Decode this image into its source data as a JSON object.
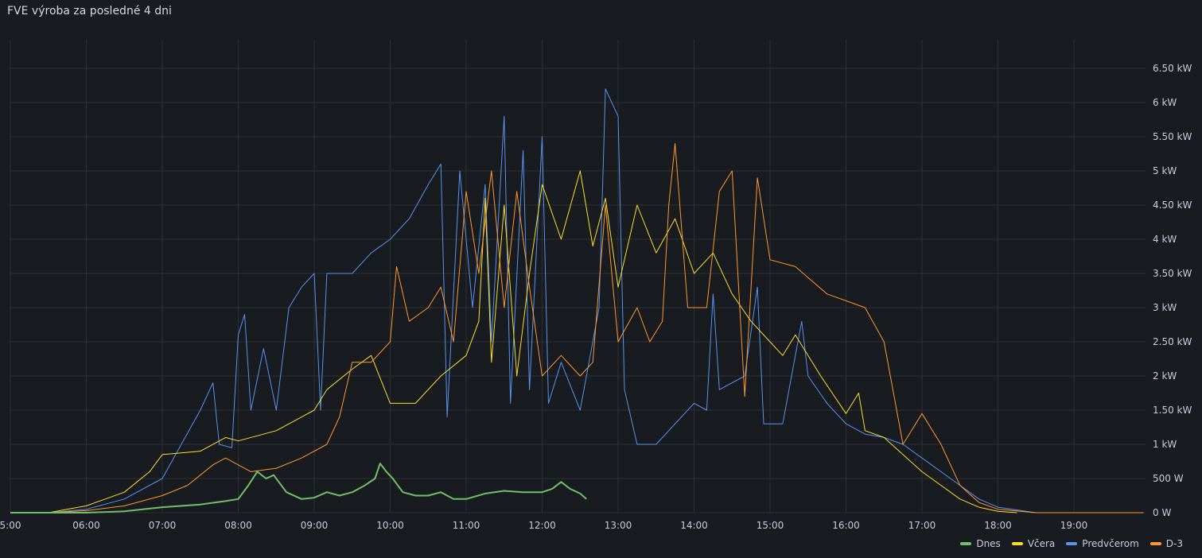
{
  "panel": {
    "title": "FVE výroba za posledné 4 dni"
  },
  "chart_data": {
    "type": "line",
    "title": "FVE výroba za posledné 4 dni",
    "xlabel": "",
    "ylabel": "",
    "xlim": [
      "05:00",
      "19:57"
    ],
    "ylim": [
      0,
      6.5
    ],
    "unit": "kW",
    "x_ticks": [
      "5:00",
      "06:00",
      "07:00",
      "08:00",
      "09:00",
      "10:00",
      "11:00",
      "12:00",
      "13:00",
      "14:00",
      "15:00",
      "16:00",
      "17:00",
      "18:00",
      "19:00"
    ],
    "y_ticks": [
      {
        "v": 0,
        "label": "0 W"
      },
      {
        "v": 0.5,
        "label": "500 W"
      },
      {
        "v": 1,
        "label": "1 kW"
      },
      {
        "v": 1.5,
        "label": "1.50 kW"
      },
      {
        "v": 2,
        "label": "2 kW"
      },
      {
        "v": 2.5,
        "label": "2.50 kW"
      },
      {
        "v": 3,
        "label": "3 kW"
      },
      {
        "v": 3.5,
        "label": "3.50 kW"
      },
      {
        "v": 4,
        "label": "4 kW"
      },
      {
        "v": 4.5,
        "label": "4.50 kW"
      },
      {
        "v": 5,
        "label": "5 kW"
      },
      {
        "v": 5.5,
        "label": "5.50 kW"
      },
      {
        "v": 6,
        "label": "6 kW"
      },
      {
        "v": 6.5,
        "label": "6.50 kW"
      }
    ],
    "grid": true,
    "legend_position": "bottom-right",
    "series": [
      {
        "name": "Predvčerom",
        "color": "#5794f2",
        "points": [
          [
            "05:30",
            0
          ],
          [
            "06:00",
            0.05
          ],
          [
            "06:30",
            0.2
          ],
          [
            "07:00",
            0.5
          ],
          [
            "07:15",
            1.0
          ],
          [
            "07:30",
            1.5
          ],
          [
            "07:40",
            1.9
          ],
          [
            "07:45",
            1.0
          ],
          [
            "07:55",
            0.95
          ],
          [
            "08:00",
            2.6
          ],
          [
            "08:05",
            2.9
          ],
          [
            "08:10",
            1.5
          ],
          [
            "08:20",
            2.4
          ],
          [
            "08:30",
            1.5
          ],
          [
            "08:40",
            3.0
          ],
          [
            "08:50",
            3.3
          ],
          [
            "09:00",
            3.5
          ],
          [
            "09:05",
            1.5
          ],
          [
            "09:10",
            3.5
          ],
          [
            "09:30",
            3.5
          ],
          [
            "09:45",
            3.8
          ],
          [
            "10:00",
            4.0
          ],
          [
            "10:15",
            4.3
          ],
          [
            "10:30",
            4.8
          ],
          [
            "10:40",
            5.1
          ],
          [
            "10:45",
            1.4
          ],
          [
            "10:55",
            5.0
          ],
          [
            "11:05",
            3.0
          ],
          [
            "11:15",
            4.8
          ],
          [
            "11:20",
            2.5
          ],
          [
            "11:30",
            5.8
          ],
          [
            "11:35",
            1.6
          ],
          [
            "11:45",
            5.3
          ],
          [
            "11:50",
            1.8
          ],
          [
            "12:00",
            5.5
          ],
          [
            "12:05",
            1.6
          ],
          [
            "12:15",
            2.2
          ],
          [
            "12:30",
            1.5
          ],
          [
            "12:45",
            3.0
          ],
          [
            "12:50",
            6.2
          ],
          [
            "13:00",
            5.8
          ],
          [
            "13:05",
            1.8
          ],
          [
            "13:15",
            1.0
          ],
          [
            "13:30",
            1.0
          ],
          [
            "13:45",
            1.3
          ],
          [
            "14:00",
            1.6
          ],
          [
            "14:10",
            1.5
          ],
          [
            "14:15",
            3.2
          ],
          [
            "14:20",
            1.8
          ],
          [
            "14:40",
            2.0
          ],
          [
            "14:50",
            3.3
          ],
          [
            "14:55",
            1.3
          ],
          [
            "15:10",
            1.3
          ],
          [
            "15:25",
            2.8
          ],
          [
            "15:30",
            2.0
          ],
          [
            "15:45",
            1.6
          ],
          [
            "16:00",
            1.3
          ],
          [
            "16:15",
            1.15
          ],
          [
            "16:30",
            1.1
          ],
          [
            "16:45",
            1.0
          ],
          [
            "17:00",
            0.8
          ],
          [
            "17:15",
            0.6
          ],
          [
            "17:30",
            0.4
          ],
          [
            "17:45",
            0.2
          ],
          [
            "18:00",
            0.08
          ],
          [
            "18:30",
            0
          ]
        ]
      },
      {
        "name": "Včera",
        "color": "#fade2a",
        "points": [
          [
            "05:30",
            0
          ],
          [
            "06:00",
            0.1
          ],
          [
            "06:30",
            0.3
          ],
          [
            "06:50",
            0.6
          ],
          [
            "07:00",
            0.85
          ],
          [
            "07:30",
            0.9
          ],
          [
            "07:50",
            1.1
          ],
          [
            "08:00",
            1.05
          ],
          [
            "08:30",
            1.2
          ],
          [
            "09:00",
            1.5
          ],
          [
            "09:10",
            1.8
          ],
          [
            "09:30",
            2.1
          ],
          [
            "09:45",
            2.3
          ],
          [
            "10:00",
            1.6
          ],
          [
            "10:20",
            1.6
          ],
          [
            "10:40",
            2.0
          ],
          [
            "11:00",
            2.3
          ],
          [
            "11:10",
            2.8
          ],
          [
            "11:15",
            4.6
          ],
          [
            "11:20",
            2.2
          ],
          [
            "11:30",
            4.5
          ],
          [
            "11:40",
            2.0
          ],
          [
            "11:50",
            3.5
          ],
          [
            "12:00",
            4.8
          ],
          [
            "12:15",
            4.0
          ],
          [
            "12:30",
            5.0
          ],
          [
            "12:40",
            3.9
          ],
          [
            "12:50",
            4.6
          ],
          [
            "13:00",
            3.3
          ],
          [
            "13:15",
            4.5
          ],
          [
            "13:30",
            3.8
          ],
          [
            "13:45",
            4.3
          ],
          [
            "14:00",
            3.5
          ],
          [
            "14:15",
            3.8
          ],
          [
            "14:30",
            3.2
          ],
          [
            "14:45",
            2.8
          ],
          [
            "15:00",
            2.5
          ],
          [
            "15:10",
            2.3
          ],
          [
            "15:20",
            2.6
          ],
          [
            "15:40",
            2.0
          ],
          [
            "16:00",
            1.45
          ],
          [
            "16:10",
            1.75
          ],
          [
            "16:15",
            1.2
          ],
          [
            "16:30",
            1.1
          ],
          [
            "16:45",
            0.85
          ],
          [
            "17:00",
            0.6
          ],
          [
            "17:15",
            0.4
          ],
          [
            "17:30",
            0.2
          ],
          [
            "17:45",
            0.08
          ],
          [
            "18:00",
            0.02
          ],
          [
            "18:15",
            0
          ]
        ]
      },
      {
        "name": "D-3",
        "color": "#ff9830",
        "points": [
          [
            "05:30",
            0
          ],
          [
            "06:00",
            0.03
          ],
          [
            "06:30",
            0.1
          ],
          [
            "07:00",
            0.25
          ],
          [
            "07:20",
            0.4
          ],
          [
            "07:40",
            0.7
          ],
          [
            "07:50",
            0.8
          ],
          [
            "08:00",
            0.7
          ],
          [
            "08:10",
            0.6
          ],
          [
            "08:30",
            0.65
          ],
          [
            "08:50",
            0.8
          ],
          [
            "09:10",
            1.0
          ],
          [
            "09:20",
            1.4
          ],
          [
            "09:30",
            2.2
          ],
          [
            "09:45",
            2.2
          ],
          [
            "10:00",
            2.5
          ],
          [
            "10:05",
            3.6
          ],
          [
            "10:15",
            2.8
          ],
          [
            "10:30",
            3.0
          ],
          [
            "10:40",
            3.3
          ],
          [
            "10:50",
            2.5
          ],
          [
            "11:00",
            4.7
          ],
          [
            "11:10",
            3.5
          ],
          [
            "11:20",
            5.0
          ],
          [
            "11:30",
            3.0
          ],
          [
            "11:40",
            4.7
          ],
          [
            "11:50",
            3.3
          ],
          [
            "12:00",
            2.0
          ],
          [
            "12:15",
            2.3
          ],
          [
            "12:30",
            2.0
          ],
          [
            "12:40",
            2.2
          ],
          [
            "12:50",
            4.5
          ],
          [
            "13:00",
            2.5
          ],
          [
            "13:15",
            3.0
          ],
          [
            "13:25",
            2.5
          ],
          [
            "13:35",
            2.8
          ],
          [
            "13:40",
            4.5
          ],
          [
            "13:45",
            5.4
          ],
          [
            "13:55",
            3.0
          ],
          [
            "14:10",
            3.0
          ],
          [
            "14:20",
            4.7
          ],
          [
            "14:30",
            5.0
          ],
          [
            "14:40",
            1.7
          ],
          [
            "14:50",
            4.9
          ],
          [
            "15:00",
            3.7
          ],
          [
            "15:20",
            3.6
          ],
          [
            "15:45",
            3.2
          ],
          [
            "16:15",
            3.0
          ],
          [
            "16:30",
            2.5
          ],
          [
            "16:45",
            1.0
          ],
          [
            "17:00",
            1.45
          ],
          [
            "17:15",
            1.0
          ],
          [
            "17:30",
            0.4
          ],
          [
            "17:45",
            0.15
          ],
          [
            "18:00",
            0.05
          ],
          [
            "18:30",
            0
          ],
          [
            "19:55",
            0
          ]
        ]
      },
      {
        "name": "Dnes",
        "color": "#73bf69",
        "points": [
          [
            "05:00",
            0
          ],
          [
            "06:00",
            0
          ],
          [
            "06:30",
            0.02
          ],
          [
            "07:00",
            0.08
          ],
          [
            "07:30",
            0.12
          ],
          [
            "07:50",
            0.17
          ],
          [
            "08:00",
            0.2
          ],
          [
            "08:08",
            0.4
          ],
          [
            "08:15",
            0.6
          ],
          [
            "08:22",
            0.5
          ],
          [
            "08:28",
            0.55
          ],
          [
            "08:38",
            0.3
          ],
          [
            "08:50",
            0.2
          ],
          [
            "09:00",
            0.22
          ],
          [
            "09:10",
            0.3
          ],
          [
            "09:20",
            0.25
          ],
          [
            "09:30",
            0.3
          ],
          [
            "09:40",
            0.4
          ],
          [
            "09:48",
            0.5
          ],
          [
            "09:52",
            0.72
          ],
          [
            "09:57",
            0.6
          ],
          [
            "10:02",
            0.5
          ],
          [
            "10:10",
            0.3
          ],
          [
            "10:20",
            0.25
          ],
          [
            "10:30",
            0.25
          ],
          [
            "10:40",
            0.3
          ],
          [
            "10:50",
            0.2
          ],
          [
            "11:00",
            0.2
          ],
          [
            "11:15",
            0.28
          ],
          [
            "11:30",
            0.32
          ],
          [
            "11:45",
            0.3
          ],
          [
            "12:00",
            0.3
          ],
          [
            "12:08",
            0.35
          ],
          [
            "12:15",
            0.45
          ],
          [
            "12:22",
            0.35
          ],
          [
            "12:30",
            0.28
          ],
          [
            "12:35",
            0.2
          ]
        ]
      }
    ]
  },
  "legend": [
    {
      "name": "Dnes",
      "color": "#73bf69"
    },
    {
      "name": "Včera",
      "color": "#fade2a"
    },
    {
      "name": "Predvčerom",
      "color": "#5794f2"
    },
    {
      "name": "D-3",
      "color": "#ff9830"
    }
  ]
}
